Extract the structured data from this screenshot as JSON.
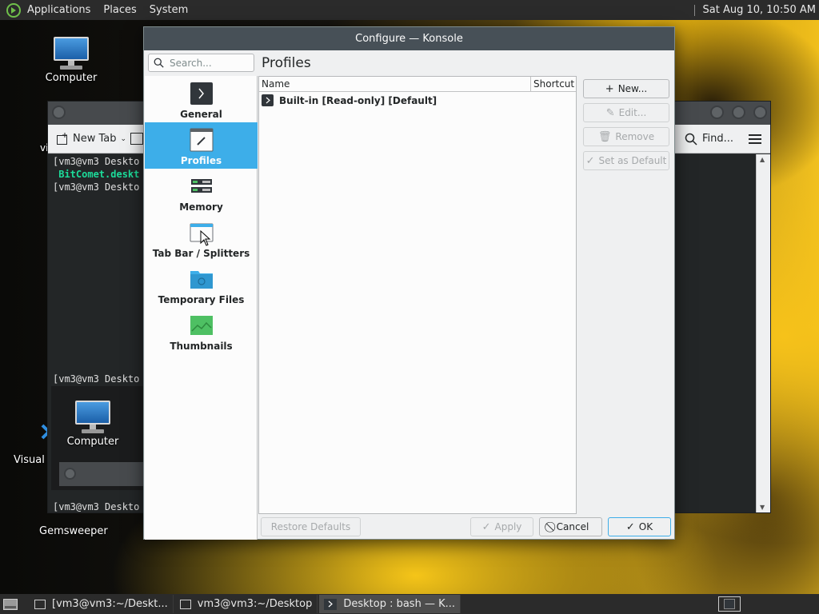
{
  "top_panel": {
    "menus": [
      "Applications",
      "Places",
      "System"
    ],
    "clock": "Sat Aug 10, 10:50 AM"
  },
  "desktop": {
    "icons": [
      {
        "label": "Computer"
      },
      {
        "label": "Computer"
      },
      {
        "label": "Visual S"
      },
      {
        "label": "Gemsweeper"
      },
      {
        "label": "vi"
      }
    ]
  },
  "konsole": {
    "toolbar": {
      "new_tab": "New Tab",
      "find": "Find..."
    },
    "lines": [
      {
        "text": "[vm3@vm3 Deskto"
      },
      {
        "text": " BitComet.deskt"
      },
      {
        "text": "[vm3@vm3 Deskto"
      },
      {
        "text": "[vm3@vm3 Deskto"
      },
      {
        "text": "[vm3@vm3 Deskto"
      }
    ]
  },
  "dialog": {
    "title": "Configure — Konsole",
    "search_placeholder": "Search...",
    "page_header": "Profiles",
    "categories": [
      {
        "label": "General",
        "icon": "terminal-icon"
      },
      {
        "label": "Profiles",
        "icon": "profile-edit-icon",
        "active": true
      },
      {
        "label": "Memory",
        "icon": "memory-icon"
      },
      {
        "label": "Tab Bar / Splitters",
        "icon": "window-tabs-icon"
      },
      {
        "label": "Temporary Files",
        "icon": "temp-folder-icon"
      },
      {
        "label": "Thumbnails",
        "icon": "image-icon"
      }
    ],
    "table": {
      "columns": [
        "Name",
        "Shortcut"
      ],
      "rows": [
        {
          "name": "Built-in [Read-only] [Default]",
          "shortcut": ""
        }
      ]
    },
    "actions": {
      "new": "New...",
      "edit": "Edit...",
      "remove": "Remove",
      "set_default": "Set as Default"
    },
    "footer": {
      "restore_defaults": "Restore Defaults",
      "apply": "Apply",
      "cancel": "Cancel",
      "ok": "OK"
    }
  },
  "taskbar": {
    "tasks": [
      {
        "label": "[vm3@vm3:~/Deskt..."
      },
      {
        "label": "vm3@vm3:~/Desktop"
      },
      {
        "label": "Desktop : bash — K..."
      }
    ]
  },
  "colors": {
    "selection": "#3daee9",
    "dialog_title_bg": "#475057",
    "panel_bg": "#2b2b2b",
    "terminal_green": "#1cdc9a"
  }
}
